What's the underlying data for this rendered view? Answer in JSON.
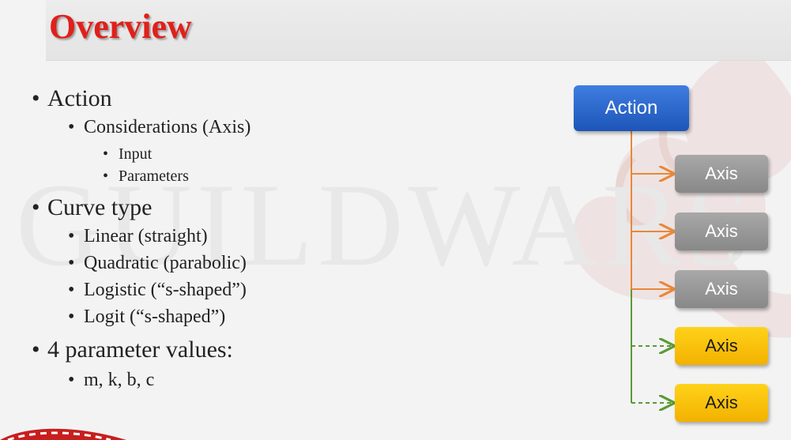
{
  "slide": {
    "title": "Overview",
    "watermark": "GUILDWARS"
  },
  "bullets": [
    {
      "level": 1,
      "text": "Action"
    },
    {
      "level": 2,
      "text": "Considerations (Axis)"
    },
    {
      "level": 3,
      "text": "Input"
    },
    {
      "level": 3,
      "text": "Parameters"
    },
    {
      "level": 1,
      "text": "Curve type"
    },
    {
      "level": 2,
      "text": "Linear (straight)"
    },
    {
      "level": 2,
      "text": "Quadratic (parabolic)"
    },
    {
      "level": 2,
      "text": "Logistic (“s-shaped”)"
    },
    {
      "level": 2,
      "text": "Logit (“s-shaped”)"
    },
    {
      "level": 1,
      "text": "4 parameter values:"
    },
    {
      "level": 2,
      "text": "m, k, b, c"
    }
  ],
  "diagram": {
    "action_label": "Action",
    "axis_boxes": [
      {
        "label": "Axis",
        "color": "#999999",
        "connector": "solid",
        "connector_color": "#e8883a"
      },
      {
        "label": "Axis",
        "color": "#999999",
        "connector": "solid",
        "connector_color": "#e8883a"
      },
      {
        "label": "Axis",
        "color": "#999999",
        "connector": "solid",
        "connector_color": "#e8883a"
      },
      {
        "label": "Axis",
        "color": "#f6c000",
        "connector": "dashed",
        "connector_color": "#5a9a35"
      },
      {
        "label": "Axis",
        "color": "#f6c000",
        "connector": "dashed",
        "connector_color": "#5a9a35"
      }
    ],
    "action_color": "#2e6bd0"
  }
}
